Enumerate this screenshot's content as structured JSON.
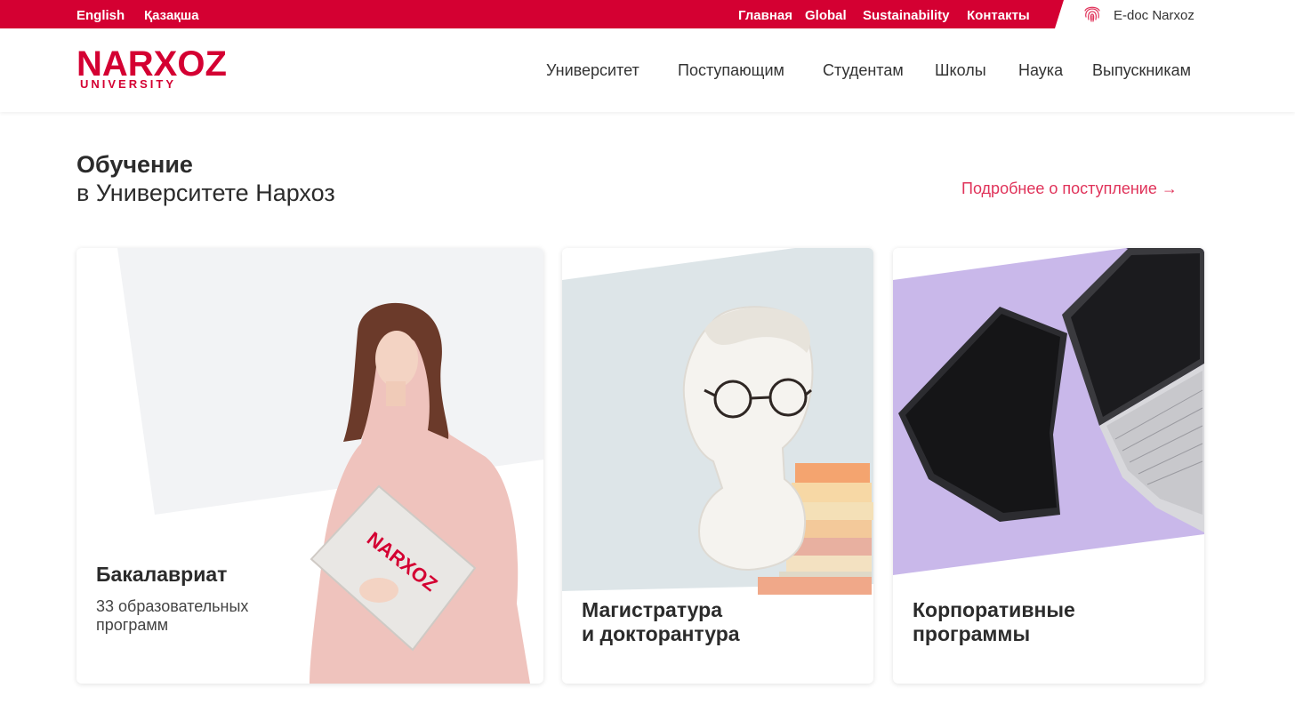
{
  "topbar": {
    "languages": [
      "English",
      "Қазақша"
    ],
    "links": [
      "Главная",
      "Global",
      "Sustainability",
      "Контакты"
    ],
    "edoc_label": "E-doc Narxoz",
    "accent": "#d40032"
  },
  "header": {
    "logo_main": "NARXOZ",
    "logo_sub": "UNIVERSITY",
    "nav": [
      "Университет",
      "Поступающим",
      "Студентам",
      "Школы",
      "Наука",
      "Выпускникам"
    ]
  },
  "section": {
    "title_bold": "Обучение",
    "title_regular": "в Университете Нархоз",
    "more_link": "Подробнее о поступление →"
  },
  "cards": [
    {
      "title": "Бакалавриат",
      "subtitle": "33 образовательных программ"
    },
    {
      "title": "Магистратура\nи докторантура",
      "subtitle": ""
    },
    {
      "title": "Корпоративные\nпрограммы",
      "subtitle": ""
    }
  ],
  "icons": {
    "edoc": "fingerprint-icon"
  }
}
